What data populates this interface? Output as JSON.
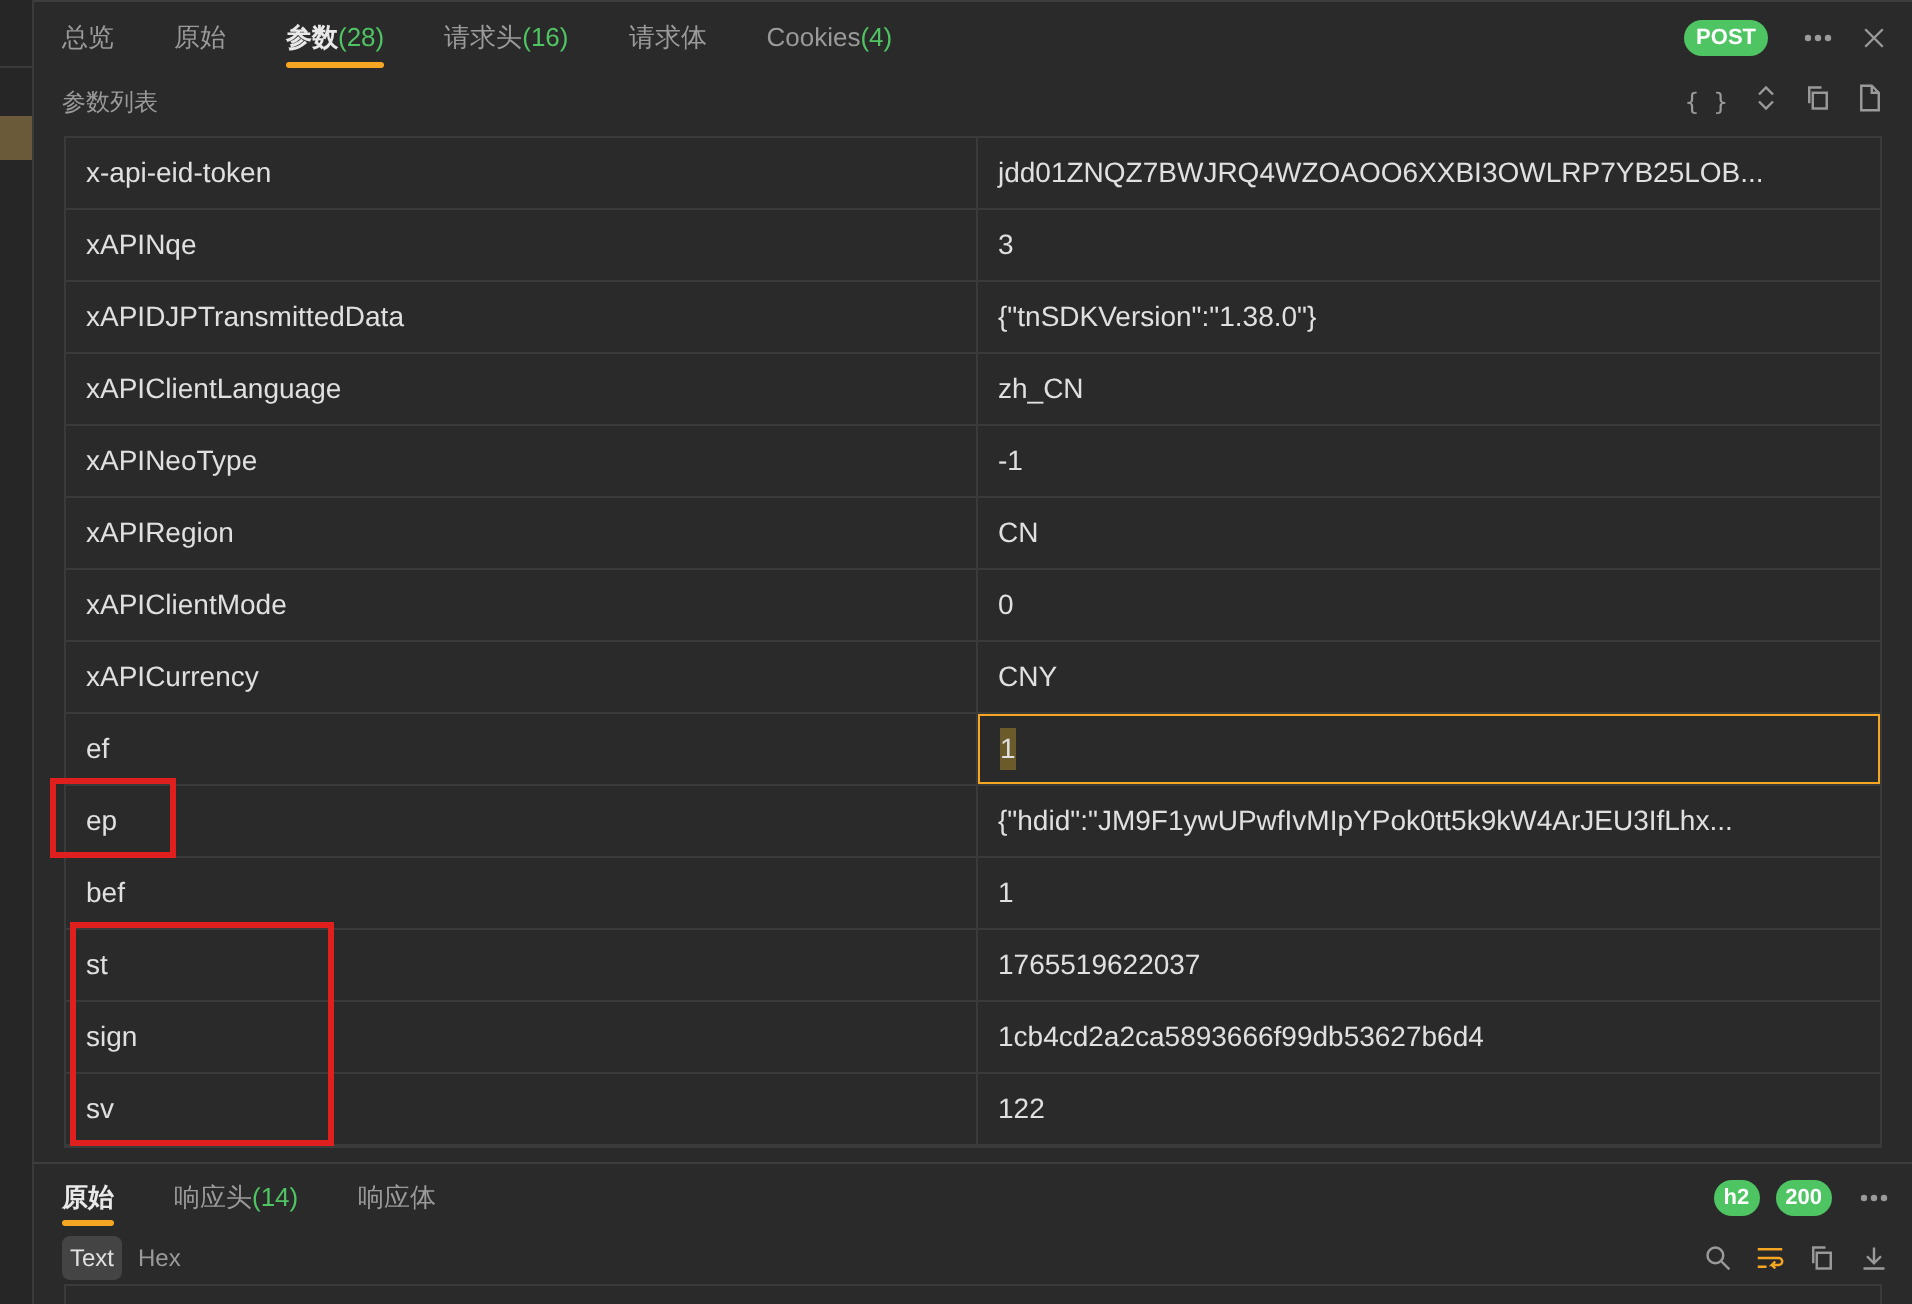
{
  "tabs": [
    {
      "label": "总览",
      "selected": false
    },
    {
      "label": "原始",
      "selected": false
    },
    {
      "label": "参数",
      "count": "(28)",
      "selected": true
    },
    {
      "label": "请求头",
      "count": "(16)",
      "selected": false
    },
    {
      "label": "请求体",
      "selected": false
    },
    {
      "label": "Cookies",
      "count": "(4)",
      "selected": false
    }
  ],
  "method": "POST",
  "section_title": "参数列表",
  "format_button": "{ }",
  "rows": [
    {
      "key": "x-api-eid-token",
      "value": "jdd01ZNQZ7BWJRQ4WZOAOO6XXBI3OWLRP7YB25LOB...",
      "selected": false,
      "boxed": false
    },
    {
      "key": "xAPINqe",
      "value": "3",
      "selected": false,
      "boxed": false
    },
    {
      "key": "xAPIDJPTransmittedData",
      "value": "{\"tnSDKVersion\":\"1.38.0\"}",
      "selected": false,
      "boxed": false
    },
    {
      "key": "xAPIClientLanguage",
      "value": "zh_CN",
      "selected": false,
      "boxed": false
    },
    {
      "key": "xAPINeoType",
      "value": "-1",
      "selected": false,
      "boxed": false
    },
    {
      "key": "xAPIRegion",
      "value": "CN",
      "selected": false,
      "boxed": false
    },
    {
      "key": "xAPIClientMode",
      "value": "0",
      "selected": false,
      "boxed": false
    },
    {
      "key": "xAPICurrency",
      "value": "CNY",
      "selected": false,
      "boxed": false
    },
    {
      "key": "ef",
      "value": "1",
      "selected": true,
      "boxed": false
    },
    {
      "key": "ep",
      "value": "{\"hdid\":\"JM9F1ywUPwfIvMIpYPok0tt5k9kW4ArJEU3IfLhx...",
      "selected": false,
      "boxed": true
    },
    {
      "key": "bef",
      "value": "1",
      "selected": false,
      "boxed": false
    },
    {
      "key": "st",
      "value": "1765519622037",
      "selected": false,
      "boxed": true
    },
    {
      "key": "sign",
      "value": "1cb4cd2a2ca5893666f99db53627b6d4",
      "selected": false,
      "boxed": true
    },
    {
      "key": "sv",
      "value": "122",
      "selected": false,
      "boxed": true
    }
  ],
  "response": {
    "tabs": [
      {
        "label": "原始",
        "selected": true
      },
      {
        "label": "响应头",
        "count": "(14)",
        "selected": false
      },
      {
        "label": "响应体",
        "selected": false
      }
    ],
    "protocol": "h2",
    "status": "200",
    "formats": [
      {
        "label": "Text",
        "selected": true
      },
      {
        "label": "Hex",
        "selected": false
      }
    ],
    "wrap_on": true
  }
}
